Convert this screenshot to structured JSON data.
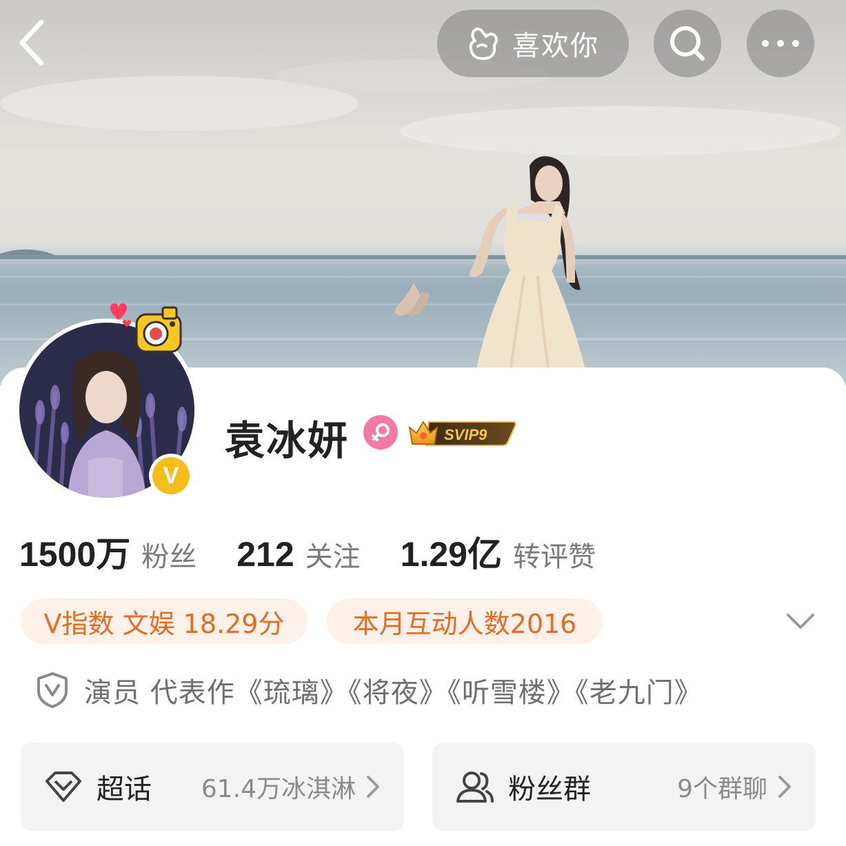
{
  "header": {
    "like_button_label": "喜欢你"
  },
  "profile": {
    "name": "袁冰妍",
    "verified_badge": "V",
    "vip_badge": "SVIP9"
  },
  "stats": [
    {
      "value": "1500万",
      "label": "粉丝"
    },
    {
      "value": "212",
      "label": "关注"
    },
    {
      "value": "1.29亿",
      "label": "转评赞"
    }
  ],
  "tags": [
    {
      "text": "V指数 文娱 18.29分"
    },
    {
      "text": "本月互动人数2016"
    }
  ],
  "description": "演员 代表作《琉璃》《将夜》《听雪楼》《老九门》",
  "entries": [
    {
      "title": "超话",
      "sub": "61.4万冰淇淋"
    },
    {
      "title": "粉丝群",
      "sub": "9个群聊"
    }
  ],
  "colors": {
    "accent_orange": "#ea6a1f",
    "tag_bg": "#fdf1ea",
    "verified_gold": "#f5bd1a",
    "female_pink": "#f27aa6",
    "card_bg": "#f3f3f3"
  }
}
